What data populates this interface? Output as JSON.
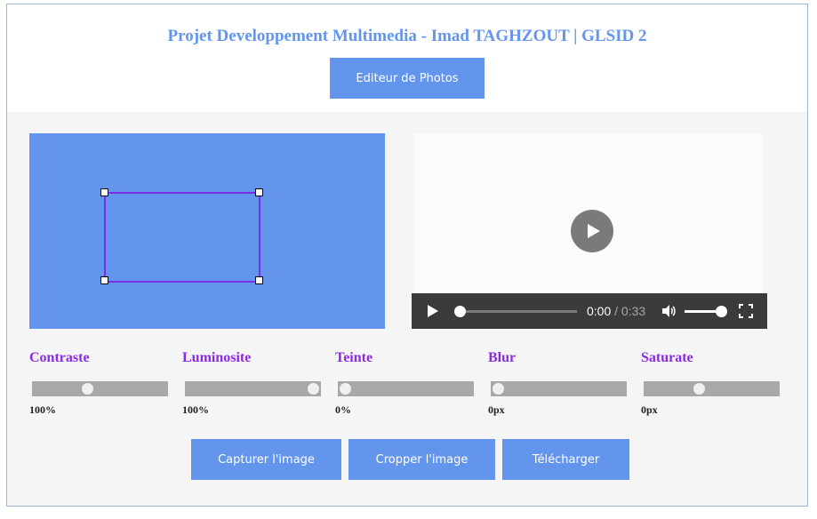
{
  "header": {
    "title": "Projet Developpement Multimedia - Imad TAGHZOUT | GLSID 2",
    "editor_button": "Editeur de Photos"
  },
  "video": {
    "current_time": "0:00",
    "total_time": "/ 0:33",
    "progress": 0,
    "volume": 1
  },
  "sliders": [
    {
      "label": "Contraste",
      "value": "100%",
      "level": 0.4
    },
    {
      "label": "Luminosite",
      "value": "100%",
      "level": 1.0
    },
    {
      "label": "Teinte",
      "value": "0%",
      "level": 0.0
    },
    {
      "label": "Blur",
      "value": "0px",
      "level": 0.0
    },
    {
      "label": "Saturate",
      "value": "0px",
      "level": 0.4
    }
  ],
  "actions": {
    "capture": "Capturer l'image",
    "crop": "Cropper l'image",
    "download": "Télécharger"
  },
  "colors": {
    "accent": "#6495ed",
    "label": "#8b2be2",
    "crop_border": "#7b2de6"
  },
  "icons": [
    "play-icon",
    "volume-icon",
    "fullscreen-icon"
  ]
}
